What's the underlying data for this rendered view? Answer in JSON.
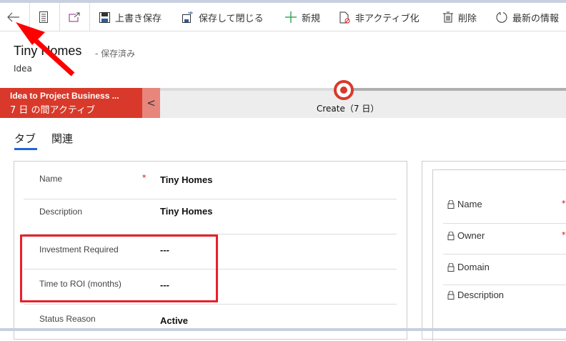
{
  "toolbar": {
    "items": [
      {
        "label": "上書き保存",
        "icon": "save-icon"
      },
      {
        "label": "保存して閉じる",
        "icon": "save-close-icon"
      },
      {
        "label": "新規",
        "icon": "plus-icon"
      },
      {
        "label": "非アクティブ化",
        "icon": "deactivate-icon"
      },
      {
        "label": "削除",
        "icon": "trash-icon"
      },
      {
        "label": "最新の情報",
        "icon": "refresh-icon"
      }
    ]
  },
  "header": {
    "title": "Tiny Homes",
    "status": "- 保存済み",
    "entity": "Idea"
  },
  "bpf": {
    "process_name": "Idea to Project Business ...",
    "duration": "7 日 の間アクティブ",
    "stage": "Create（7 日）",
    "collapse": "<"
  },
  "tabs": [
    {
      "label": "タブ",
      "active": true
    },
    {
      "label": "関連"
    }
  ],
  "form": {
    "fields": [
      {
        "label": "Name",
        "value": "Tiny Homes",
        "required": "*"
      },
      {
        "label": "Description",
        "value": "Tiny Homes"
      },
      {
        "label": "Investment Required",
        "value": "---"
      },
      {
        "label": "Time to ROI (months)",
        "value": "---"
      },
      {
        "label": "Status Reason",
        "value": "Active"
      }
    ]
  },
  "side": {
    "fields": [
      {
        "label": "Name",
        "required": "*"
      },
      {
        "label": "Owner",
        "required": "*"
      },
      {
        "label": "Domain"
      },
      {
        "label": "Description"
      }
    ]
  },
  "colors": {
    "accent": "#2266d8",
    "stage": "#d9392a",
    "highlight": "#e8202a"
  }
}
